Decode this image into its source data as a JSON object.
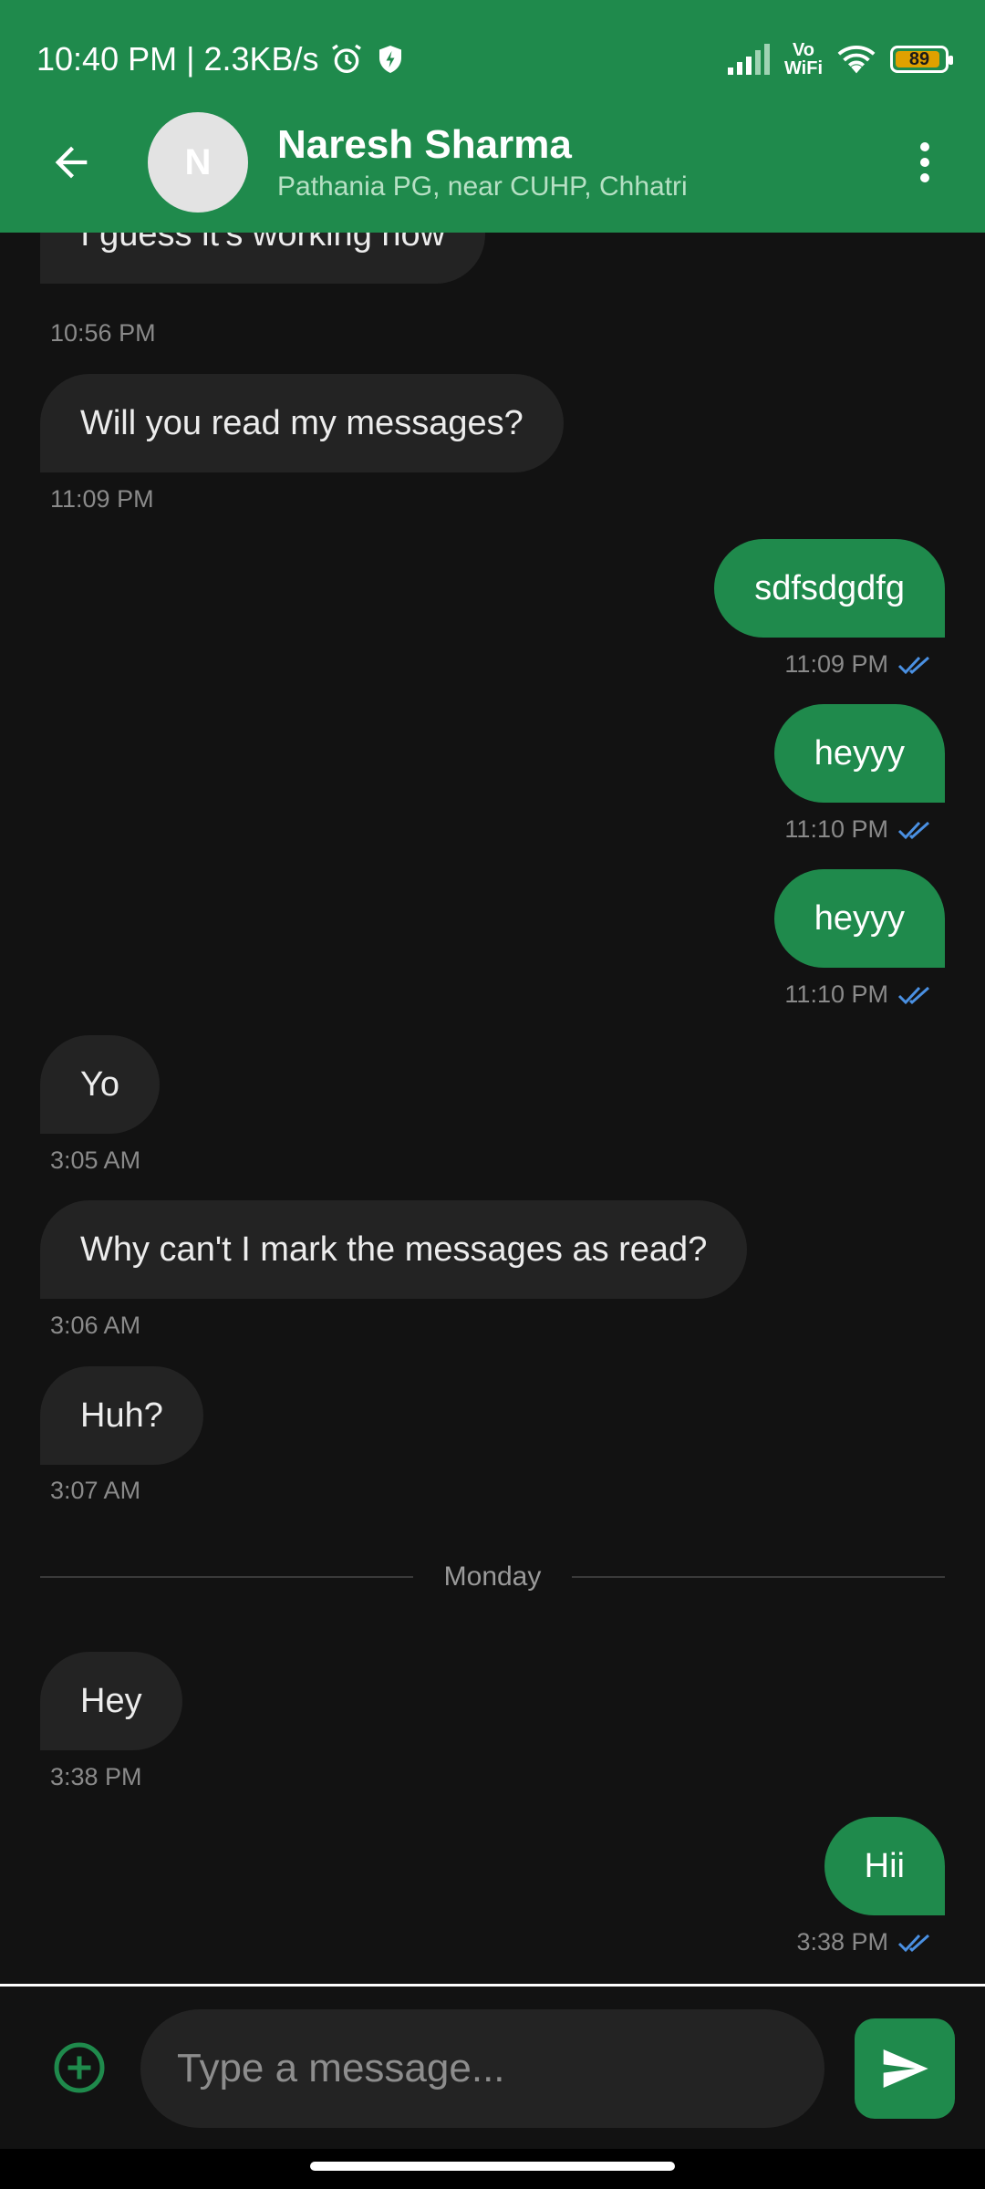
{
  "status_bar": {
    "time_speed": "10:40 PM | 2.3KB/s",
    "vowifi_line1": "Vo",
    "vowifi_line2": "WiFi",
    "battery": "89",
    "icons": [
      "alarm-icon",
      "shield-bolt-icon",
      "signal-icon",
      "vowifi-icon",
      "wifi-icon",
      "battery-icon"
    ]
  },
  "header": {
    "avatar_initial": "N",
    "name": "Naresh Sharma",
    "subtitle": "Pathania PG, near CUHP, Chhatri",
    "icons": [
      "back-arrow-icon",
      "more-vert-icon"
    ]
  },
  "messages": [
    {
      "direction": "in",
      "text": "I guess it's working now",
      "time": "10:56 PM"
    },
    {
      "direction": "in",
      "text": "Will you read my messages?",
      "time": "11:09 PM"
    },
    {
      "direction": "out",
      "text": "sdfsdgdfg",
      "time": "11:09 PM",
      "read": true
    },
    {
      "direction": "out",
      "text": "heyyy",
      "time": "11:10 PM",
      "read": true
    },
    {
      "direction": "out",
      "text": "heyyy",
      "time": "11:10 PM",
      "read": true
    },
    {
      "direction": "in",
      "text": "Yo",
      "time": "3:05 AM"
    },
    {
      "direction": "in",
      "text": "Why can't I mark the messages as read?",
      "time": "3:06 AM"
    },
    {
      "direction": "in",
      "text": "Huh?",
      "time": "3:07 AM"
    },
    {
      "direction": "in",
      "text": "Hey",
      "time": "3:38 PM"
    },
    {
      "direction": "out",
      "text": "Hii",
      "time": "3:38 PM",
      "read": true
    }
  ],
  "divider": {
    "label": "Monday"
  },
  "composer": {
    "placeholder": "Type a message...",
    "icons": [
      "add-circle-icon",
      "send-icon"
    ]
  },
  "colors": {
    "brand_green": "#1f8a4c",
    "background": "#121212",
    "incoming_bubble": "#232323",
    "read_tick": "#4a90e2"
  }
}
